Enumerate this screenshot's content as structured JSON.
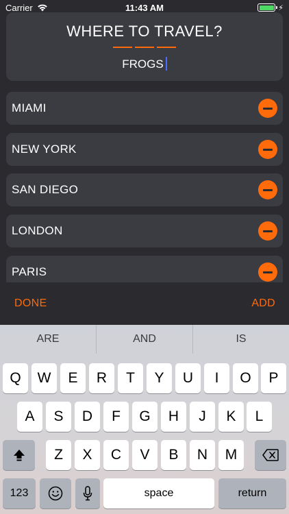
{
  "status_bar": {
    "carrier": "Carrier",
    "time": "11:43 AM"
  },
  "header": {
    "title": "WHERE TO TRAVEL?",
    "input_value": "FROGS"
  },
  "cities": [
    {
      "label": "MIAMI"
    },
    {
      "label": "NEW YORK"
    },
    {
      "label": "SAN DIEGO"
    },
    {
      "label": "LONDON"
    },
    {
      "label": "PARIS"
    }
  ],
  "toolbar": {
    "done_label": "DONE",
    "add_label": "ADD"
  },
  "keyboard": {
    "suggestions": [
      "ARE",
      "AND",
      "IS"
    ],
    "row1": [
      "Q",
      "W",
      "E",
      "R",
      "T",
      "Y",
      "U",
      "I",
      "O",
      "P"
    ],
    "row2": [
      "A",
      "S",
      "D",
      "F",
      "G",
      "H",
      "J",
      "K",
      "L"
    ],
    "row3": [
      "Z",
      "X",
      "C",
      "V",
      "B",
      "N",
      "M"
    ],
    "numbers_label": "123",
    "space_label": "space",
    "return_label": "return"
  },
  "colors": {
    "accent": "#ff6a0a",
    "background": "#2a2a2f",
    "card": "#3b3b42",
    "caret": "#4b6cff"
  }
}
